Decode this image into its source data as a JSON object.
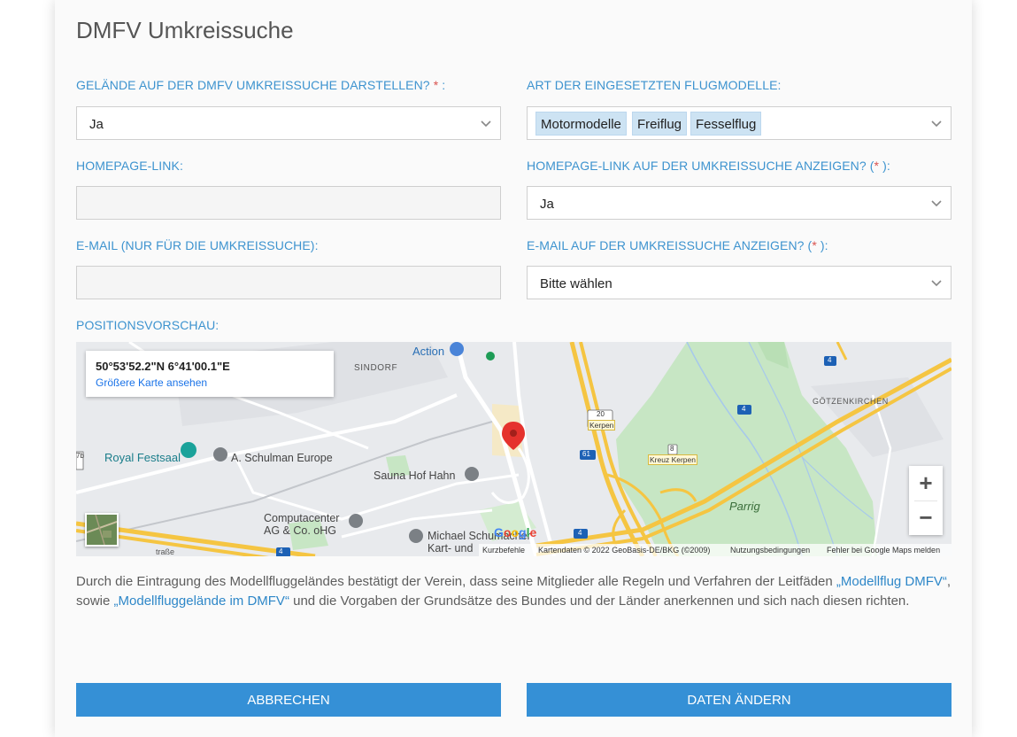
{
  "page_title": "DMFV Umkreissuche",
  "fields": {
    "display_on_search": {
      "label": "GELÄNDE AUF DER DMFV UMKREISSUCHE DARSTELLEN?",
      "required_mark": "*",
      "label_suffix": " :",
      "value": "Ja"
    },
    "model_types": {
      "label": "ART DER EINGESETZTEN FLUGMODELLE:",
      "tags": [
        "Motormodelle",
        "Freiflug",
        "Fesselflug"
      ]
    },
    "homepage_link": {
      "label": "HOMEPAGE-LINK:",
      "value": ""
    },
    "show_homepage": {
      "label_prefix": "HOMEPAGE-LINK AUF DER UMKREISSUCHE ANZEIGEN? (",
      "required_mark": "*",
      "label_suffix": " ):",
      "value": "Ja"
    },
    "email": {
      "label": "E-MAIL (NUR FÜR DIE UMKREISSUCHE):",
      "value": ""
    },
    "show_email": {
      "label_prefix": "E-MAIL AUF DER UMKREISSUCHE ANZEIGEN? (",
      "required_mark": "*",
      "label_suffix": " ):",
      "value": "Bitte wählen"
    }
  },
  "map": {
    "label": "POSITIONSVORSCHAU:",
    "coords": "50°53'52.2\"N 6°41'00.1\"E",
    "larger_map_link": "Größere Karte ansehen",
    "places": {
      "action": "Action",
      "sindorf": "SINDORF",
      "royal_festsaal": "Royal Festsaal",
      "schulman": "A. Schulman Europe",
      "sauna": "Sauna Hof Hahn",
      "computacenter_1": "Computacenter",
      "computacenter_2": "AG & Co. oHG",
      "schumacher_1": "Michael Schumacher",
      "schumacher_2": "Kart- und",
      "goetzenkirchen": "GÖTZENKIRCHEN",
      "parrig": "Parrig",
      "kreuz_kerpen": "Kreuz Kerpen",
      "kerpen": "Kerpen",
      "strasse": "traße"
    },
    "shields": [
      "4",
      "4",
      "4",
      "61",
      "20",
      "8",
      "7b",
      "7",
      "4"
    ],
    "zoom_in": "+",
    "zoom_out": "−",
    "google": "Google",
    "footer": {
      "shortcuts": "Kurzbefehle",
      "mapdata": "Kartendaten © 2022 GeoBasis-DE/BKG (©2009)",
      "terms": "Nutzungsbedingungen",
      "report": "Fehler bei Google Maps melden"
    }
  },
  "disclaimer": {
    "part1": "Durch die Eintragung des Modellfluggeländes bestätigt der Verein, dass seine Mitglieder alle Regeln und Verfahren der Leitfäden ",
    "link1": "„Modellflug DMFV“",
    "part2": ", sowie ",
    "link2": "„Modellfluggelände im DMFV“",
    "part3": " und die Vorgaben der Grundsätze des Bundes und der Länder anerkennen und sich nach diesen richten."
  },
  "buttons": {
    "cancel": "ABBRECHEN",
    "submit": "DATEN ÄNDERN"
  },
  "colors": {
    "accent": "#3590d6",
    "label": "#3d93cf",
    "required": "#d9534f",
    "tag_bg": "#cde3f3"
  }
}
